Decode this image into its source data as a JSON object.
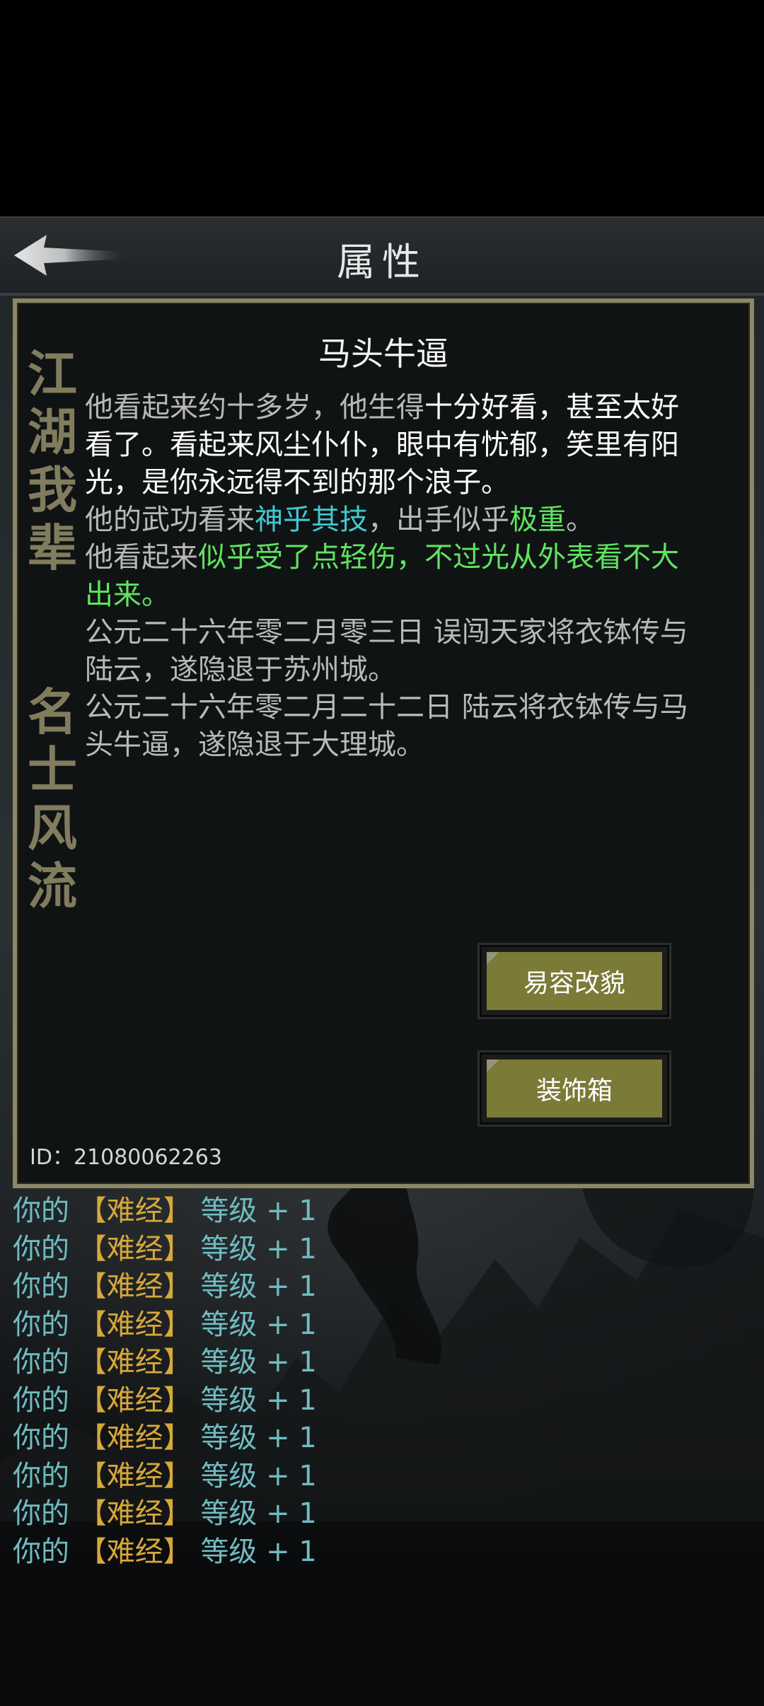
{
  "header": {
    "title": "属性",
    "back_icon": "back-arrow-icon"
  },
  "panel": {
    "vertical_text_1": "江湖我辈",
    "vertical_text_2": "名士风流",
    "name": "马头牛逼",
    "desc": {
      "l1_a": "他看起来约十多岁，他生得",
      "l1_b": "十分好看，甚至太好看了。看起来风尘仆仆，眼中有忧郁，笑里有阳光，是你永远得不到的那个浪子。",
      "l2_a": "他的武功看来",
      "l2_b": "神乎其技",
      "l2_c": "，出手似乎",
      "l2_d": "极重",
      "l2_e": "。",
      "l3_a": "他看起来",
      "l3_b": "似乎受了点轻伤，不过光从外表看不大出来。",
      "l4": "公元二十六年零二月零三日 误闯天家将衣钵传与陆云，遂隐退于苏州城。",
      "l5": "公元二十六年零二月二十二日 陆云将衣钵传与马头牛逼，遂隐退于大理城。"
    },
    "buttons": {
      "disguise": "易容改貌",
      "wardrobe": "装饰箱"
    },
    "id_text": "ID：21080062263"
  },
  "log": [
    {
      "prefix": "你的",
      "skill": "【难经】",
      "suffix": "等级 + 1"
    },
    {
      "prefix": "你的",
      "skill": "【难经】",
      "suffix": "等级 + 1"
    },
    {
      "prefix": "你的",
      "skill": "【难经】",
      "suffix": "等级 + 1"
    },
    {
      "prefix": "你的",
      "skill": "【难经】",
      "suffix": "等级 + 1"
    },
    {
      "prefix": "你的",
      "skill": "【难经】",
      "suffix": "等级 + 1"
    },
    {
      "prefix": "你的",
      "skill": "【难经】",
      "suffix": "等级 + 1"
    },
    {
      "prefix": "你的",
      "skill": "【难经】",
      "suffix": "等级 + 1"
    },
    {
      "prefix": "你的",
      "skill": "【难经】",
      "suffix": "等级 + 1"
    },
    {
      "prefix": "你的",
      "skill": "【难经】",
      "suffix": "等级 + 1"
    },
    {
      "prefix": "你的",
      "skill": "【难经】",
      "suffix": "等级 + 1"
    }
  ],
  "colors": {
    "panel_border": "#8c8764",
    "highlight_cyan": "#3fc9cf",
    "highlight_green": "#5fe45f",
    "skill_gold": "#d7a83a",
    "button_olive": "#7b7a36"
  }
}
